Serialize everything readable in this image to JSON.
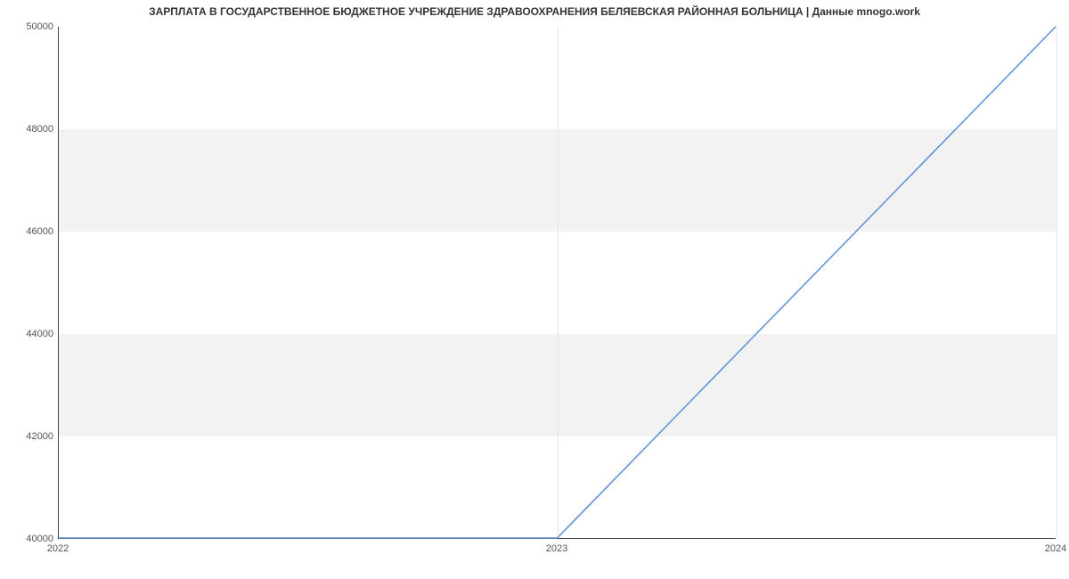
{
  "chart_data": {
    "type": "line",
    "title": "ЗАРПЛАТА В ГОСУДАРСТВЕННОЕ БЮДЖЕТНОЕ УЧРЕЖДЕНИЕ ЗДРАВООХРАНЕНИЯ БЕЛЯЕВСКАЯ РАЙОННАЯ БОЛЬНИЦА | Данные mnogo.work",
    "x": [
      2022,
      2023,
      2024
    ],
    "series": [
      {
        "name": "salary",
        "values": [
          40000,
          40000,
          50000
        ],
        "color": "#5b8fd6"
      }
    ],
    "xlabel": "",
    "ylabel": "",
    "xlim": [
      2022,
      2024
    ],
    "ylim": [
      40000,
      50000
    ],
    "xticks": [
      2022,
      2023,
      2024
    ],
    "yticks": [
      40000,
      42000,
      44000,
      46000,
      48000,
      50000
    ],
    "bands": [
      {
        "from": 42000,
        "to": 44000
      },
      {
        "from": 46000,
        "to": 48000
      }
    ],
    "band_color": "#f2f2f2"
  },
  "labels": {
    "xt0": "2022",
    "xt1": "2023",
    "xt2": "2024",
    "yt0": "40000",
    "yt1": "42000",
    "yt2": "44000",
    "yt3": "46000",
    "yt4": "48000",
    "yt5": "50000"
  }
}
